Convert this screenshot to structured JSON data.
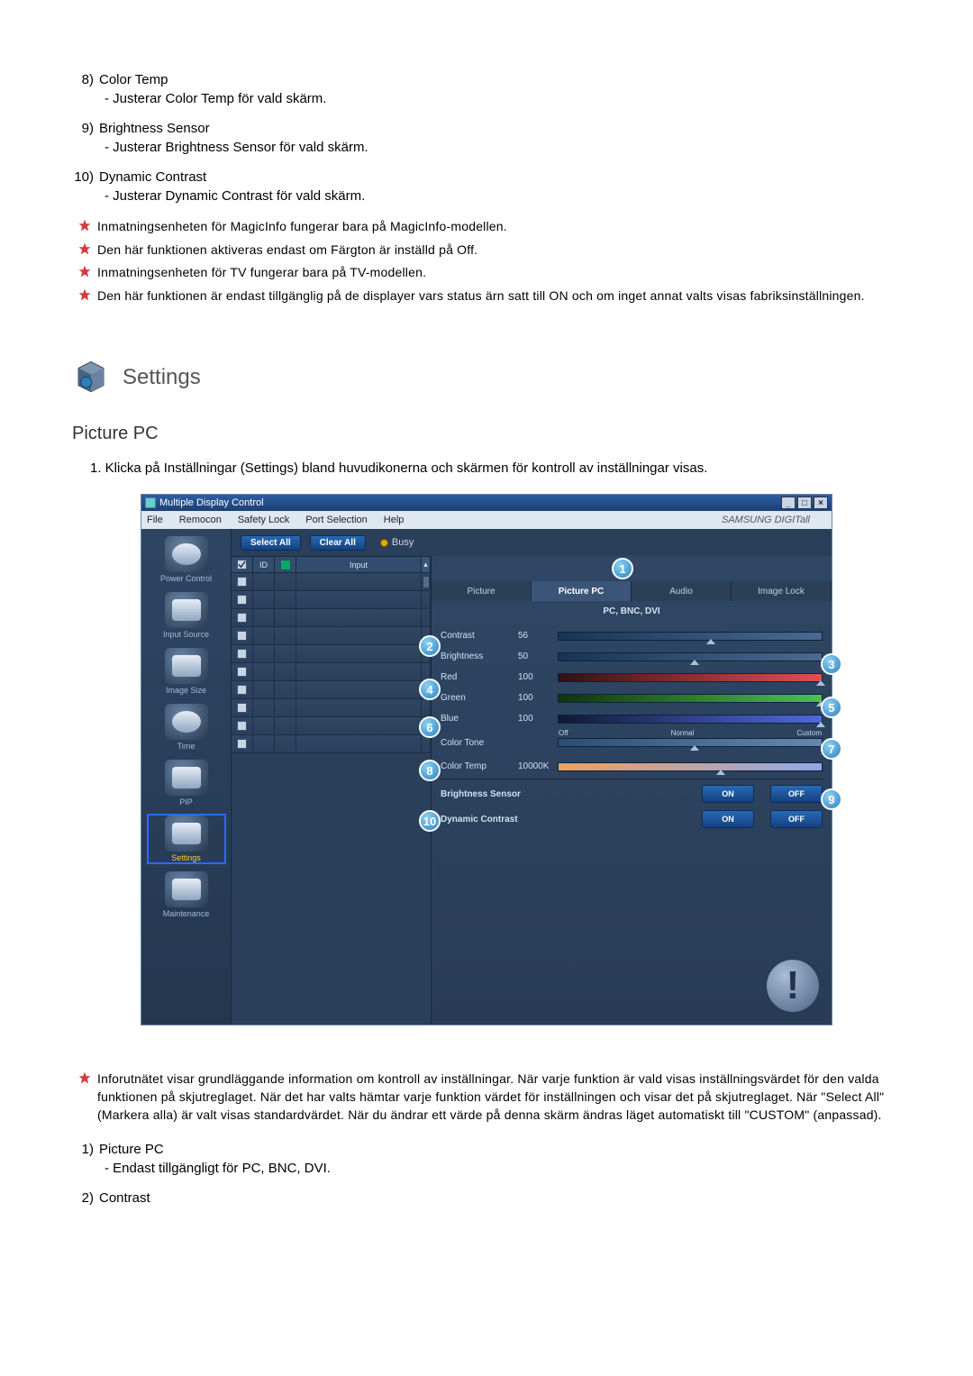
{
  "upper_items": [
    {
      "num": "8)",
      "title": "Color Temp",
      "desc": "- Justerar Color Temp för vald skärm."
    },
    {
      "num": "9)",
      "title": "Brightness Sensor",
      "desc": "- Justerar Brightness Sensor för vald skärm."
    },
    {
      "num": "10)",
      "title": "Dynamic Contrast",
      "desc": "- Justerar Dynamic Contrast för vald skärm."
    }
  ],
  "notes": [
    "Inmatningsenheten för MagicInfo fungerar bara på MagicInfo-modellen.",
    "Den här funktionen aktiveras endast om Färgton är inställd på Off.",
    "Inmatningsenheten för TV fungerar bara på TV-modellen.",
    "Den här funktionen är endast tillgänglig på de displayer vars status ärn satt till ON och om inget annat valts visas fabriksinställningen."
  ],
  "settings_header": "Settings",
  "subsection": "Picture PC",
  "intro": "1.  Klicka på Inställningar (Settings) bland huvudikonerna och skärmen för kontroll av inställningar visas.",
  "app": {
    "title": "Multiple Display Control",
    "menu": [
      "File",
      "Remocon",
      "Safety Lock",
      "Port Selection",
      "Help"
    ],
    "brand": "SAMSUNG DIGITall",
    "select_all": "Select All",
    "clear_all": "Clear All",
    "busy": "Busy",
    "sidebar": [
      "Power Control",
      "Input Source",
      "Image Size",
      "Time",
      "PIP",
      "Settings",
      "Maintenance"
    ],
    "grid_headers": [
      "",
      "ID",
      "",
      "Input"
    ],
    "tabs": [
      "Picture",
      "Picture PC",
      "Audio",
      "Image Lock"
    ],
    "panel_subtitle": "PC, BNC, DVI",
    "sliders": {
      "contrast": {
        "label": "Contrast",
        "value": "56",
        "pos": 56
      },
      "brightness": {
        "label": "Brightness",
        "value": "50",
        "pos": 50
      },
      "red": {
        "label": "Red",
        "value": "100",
        "pos": 99
      },
      "green": {
        "label": "Green",
        "value": "100",
        "pos": 99
      },
      "blue": {
        "label": "Blue",
        "value": "100",
        "pos": 99
      },
      "colortone": {
        "label": "Color Tone",
        "labels": [
          "Off",
          "Normal",
          "Custom"
        ],
        "pos": 50
      },
      "colortemp": {
        "label": "Color Temp",
        "value": "10000K",
        "pos": 60
      }
    },
    "brightness_sensor": {
      "label": "Brightness Sensor",
      "on": "ON",
      "off": "OFF"
    },
    "dynamic_contrast": {
      "label": "Dynamic Contrast",
      "on": "ON",
      "off": "OFF"
    },
    "callouts": [
      "1",
      "2",
      "3",
      "4",
      "5",
      "6",
      "7",
      "8",
      "9",
      "10"
    ]
  },
  "bottom_note": "Inforutnätet visar grundläggande information om kontroll av inställningar. När varje funktion är vald visas inställningsvärdet för den valda funktionen på skjutreglaget. När det har valts hämtar varje funktion värdet för inställningen och visar det på skjutreglaget. När \"Select All\" (Markera alla) är valt visas standardvärdet. När du ändrar ett värde på denna skärm ändras läget automatiskt till \"CUSTOM\" (anpassad).",
  "bottom_items": [
    {
      "num": "1)",
      "title": "Picture PC",
      "desc": "- Endast tillgängligt för PC, BNC, DVI."
    },
    {
      "num": "2)",
      "title": "Contrast",
      "desc": ""
    }
  ]
}
